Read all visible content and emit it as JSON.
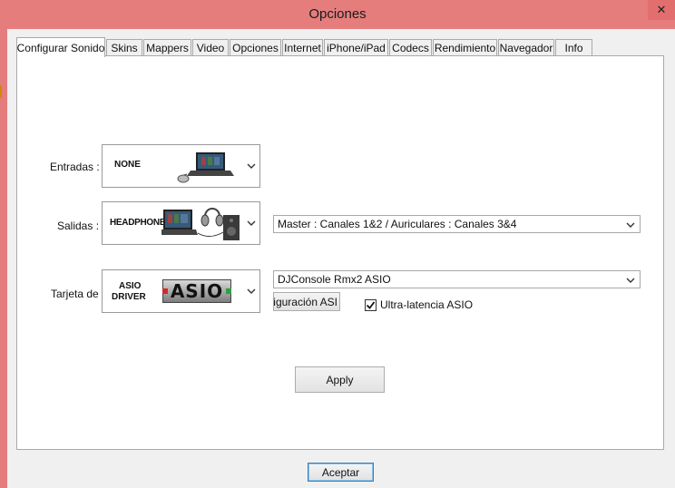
{
  "window": {
    "title": "Opciones",
    "close_glyph": "✕"
  },
  "tabs": [
    {
      "label": "Configurar Sonido",
      "active": true
    },
    {
      "label": "Skins"
    },
    {
      "label": "Mappers"
    },
    {
      "label": "Video"
    },
    {
      "label": "Opciones"
    },
    {
      "label": "Internet"
    },
    {
      "label": "iPhone/iPad"
    },
    {
      "label": "Codecs"
    },
    {
      "label": "Rendimiento"
    },
    {
      "label": "Navegador"
    },
    {
      "label": "Info"
    }
  ],
  "sound": {
    "inputs": {
      "label": "Entradas :",
      "image_text": "NONE",
      "icon": "laptop-with-mouse-icon"
    },
    "outputs": {
      "label": "Salidas :",
      "image_text": "HEADPHONES",
      "icon": "laptop-headphones-speaker-icon",
      "channel_mode": "Master : Canales 1&2 / Auriculares : Canales 3&4"
    },
    "card": {
      "label": "Tarjeta de",
      "image_text_line1": "ASIO",
      "image_text_line2": "DRIVER",
      "logo_text": "ASIO",
      "device": "DJConsole Rmx2 ASIO",
      "config_button": "nfiguración ASI",
      "ultra_latency_label": "Ultra-latencia ASIO",
      "ultra_latency_checked": true
    },
    "apply_label": "Apply"
  },
  "footer": {
    "accept_label": "Aceptar"
  },
  "colors": {
    "titlebar": "#e57d7d",
    "close": "#e36e6e",
    "asio_red": "#d62828",
    "asio_green": "#2ea043"
  }
}
